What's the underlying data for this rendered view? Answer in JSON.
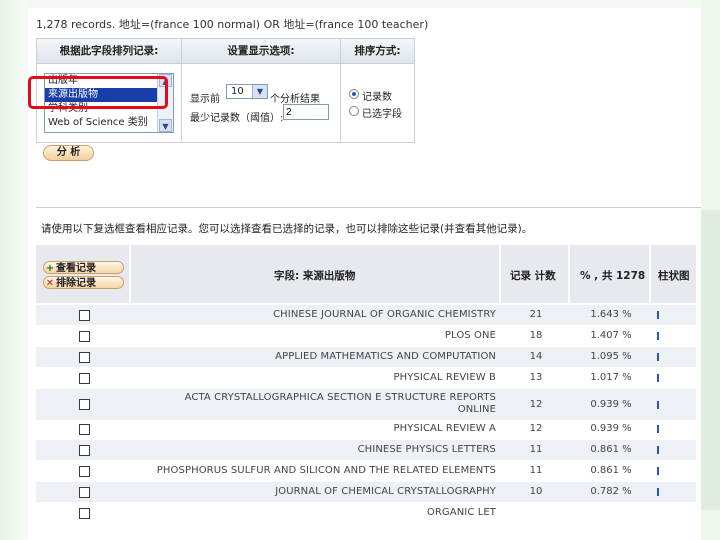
{
  "summary": {
    "records_text": "1,278 records. 地址=(france 100 normal) OR 地址=(france 100 teacher)"
  },
  "analysis_panel": {
    "headers": [
      "根据此字段排列记录:",
      "设置显示选项:",
      "排序方式:"
    ],
    "field_options": [
      "出版年",
      "来源出版物",
      "学科类别",
      "Web of Science 类别"
    ],
    "selected_field": "来源出版物",
    "show_top_label": "显示前",
    "show_top_value": "10",
    "show_top_suffix": "个分析结果",
    "min_count_label": "最少记录数（阈值）:",
    "min_count_value": "2",
    "sort_options": [
      "记录数",
      "已选字段"
    ],
    "sort_selected": "记录数",
    "analyze_label": "分 析"
  },
  "instruction": "请使用以下复选框查看相应记录。您可以选择查看已选择的记录，也可以排除这些记录(并查看其他记录)。",
  "table": {
    "view_button": "查看记录",
    "exclude_button": "排除记录",
    "view_icon": "plus-icon",
    "exclude_icon": "x-icon",
    "columns": [
      "字段: 来源出版物",
      "记录 计数",
      "% , 共 1278",
      "柱状图"
    ],
    "bar_color": "#2b55b0",
    "rows": [
      {
        "source": "CHINESE JOURNAL OF ORGANIC CHEMISTRY",
        "count": "21",
        "percent": "1.643 %"
      },
      {
        "source": "PLOS ONE",
        "count": "18",
        "percent": "1.407 %"
      },
      {
        "source": "APPLIED MATHEMATICS AND COMPUTATION",
        "count": "14",
        "percent": "1.095 %"
      },
      {
        "source": "PHYSICAL REVIEW B",
        "count": "13",
        "percent": "1.017 %"
      },
      {
        "source": "ACTA CRYSTALLOGRAPHICA SECTION E STRUCTURE REPORTS ONLINE",
        "count": "12",
        "percent": "0.939 %"
      },
      {
        "source": "PHYSICAL REVIEW A",
        "count": "12",
        "percent": "0.939 %"
      },
      {
        "source": "CHINESE PHYSICS LETTERS",
        "count": "11",
        "percent": "0.861 %"
      },
      {
        "source": "PHOSPHORUS SULFUR AND SILICON AND THE RELATED ELEMENTS",
        "count": "11",
        "percent": "0.861 %"
      },
      {
        "source": "JOURNAL OF CHEMICAL CRYSTALLOGRAPHY",
        "count": "10",
        "percent": "0.782 %"
      },
      {
        "source": "ORGANIC LET",
        "count": "",
        "percent": ""
      }
    ]
  }
}
